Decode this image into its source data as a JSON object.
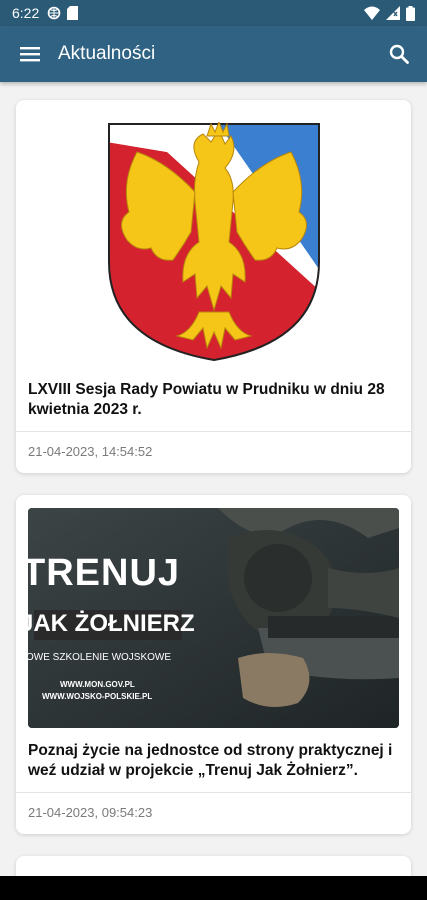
{
  "status_bar": {
    "time": "6:22",
    "icons_left": [
      "settings-gear-icon",
      "sd-card-icon"
    ],
    "icons_right": [
      "wifi-icon",
      "signal-icon",
      "battery-icon"
    ]
  },
  "app_bar": {
    "title": "Aktualności",
    "menu_icon": "menu-icon",
    "search_icon": "search-icon"
  },
  "articles": [
    {
      "image": "coat-of-arms",
      "title": "LXVIII Sesja Rady Powiatu w Prudniku w dniu 28 kwietnia 2023 r.",
      "date": "21-04-2023, 14:54:52"
    },
    {
      "image": "soldier-photo",
      "image_texts": {
        "headline1": "TRENUJ",
        "headline2": "JAK ŻOŁNIERZ",
        "subline": "OWE SZKOLENIE WOJSKOWE",
        "url1": "WWW.MON.GOV.PL",
        "url2": "WWW.WOJSKO-POLSKIE.PL"
      },
      "title": "Poznaj życie na jednostce od strony praktycznej i weź udział w projekcie „Trenuj Jak Żołnierz”.",
      "date": "21-04-2023, 09:54:23"
    }
  ],
  "colors": {
    "app_bar": "#2f6283",
    "status_bar": "#2b5a77",
    "background": "#f2f2f2",
    "coat_red": "#d4232f",
    "coat_blue": "#3b7fd1",
    "coat_gold": "#f5c518"
  }
}
